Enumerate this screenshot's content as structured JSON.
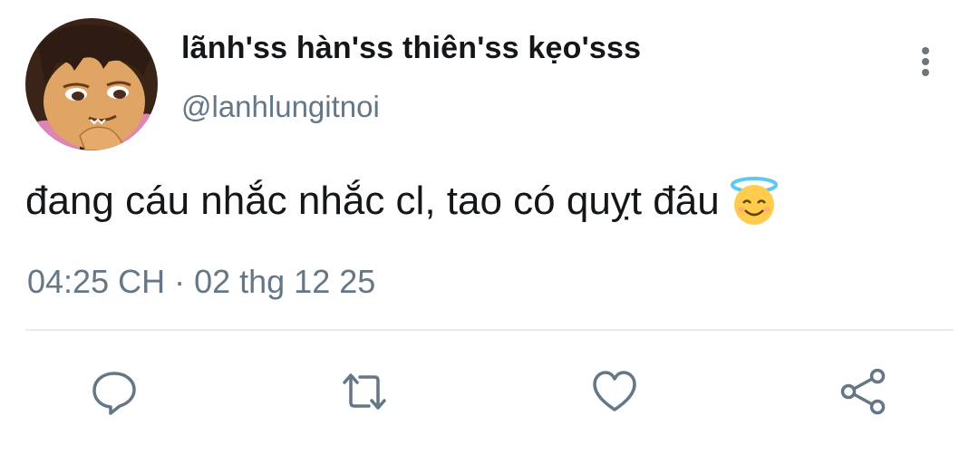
{
  "tweet": {
    "display_name": "lãnh'ss hàn'ss thiên'ss kẹo'sss",
    "handle": "@lanhlungitnoi",
    "text": "đang cáu nhắc nhắc cl, tao có quỵt đâu",
    "emoji": "smiling-face-with-halo",
    "timestamp": "04:25 CH · 02 thg 12 25"
  },
  "icons": {
    "more": "more-vertical-icon",
    "reply": "reply-icon",
    "retweet": "retweet-icon",
    "like": "heart-icon",
    "share": "share-icon"
  },
  "colors": {
    "text": "#14171a",
    "secondary": "#657786",
    "icon": "#657786",
    "divider": "#e6ecf0"
  }
}
